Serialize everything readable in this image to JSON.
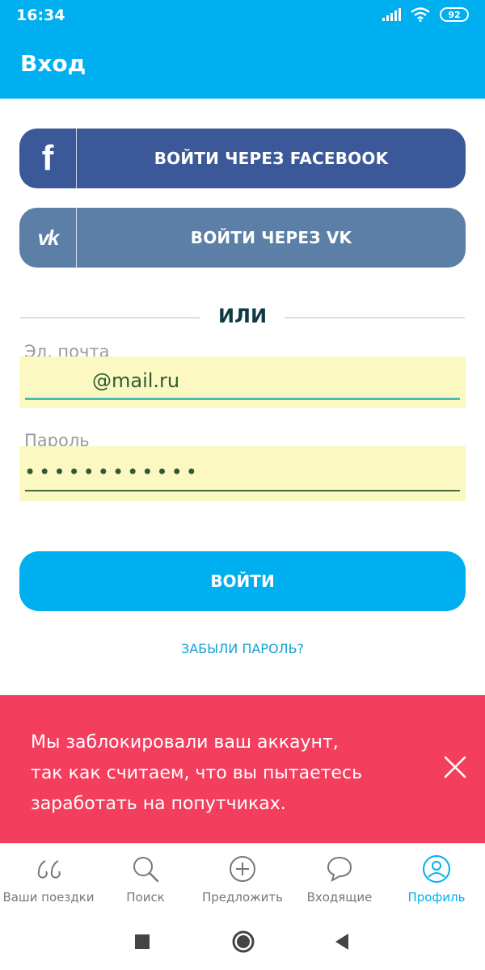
{
  "status": {
    "time": "16:34",
    "battery": "92"
  },
  "app_bar": {
    "title": "Вход"
  },
  "social": {
    "facebook_label": "ВОЙТИ ЧЕРЕЗ FACEBOOK",
    "vk_label": "ВОЙТИ ЧЕРЕЗ VK",
    "facebook_icon_glyph": "f",
    "vk_icon_glyph": "vk",
    "facebook_color": "#3b5998",
    "vk_color": "#5b7fa6"
  },
  "divider": {
    "text": "ИЛИ"
  },
  "form": {
    "email": {
      "label": "Эл. почта",
      "value": "@mail.ru"
    },
    "password": {
      "label": "Пароль",
      "value": "••••••••••••"
    },
    "submit_label": "ВОЙТИ",
    "forgot_label": "ЗАБЫЛИ ПАРОЛЬ?"
  },
  "banner": {
    "lines": [
      "Мы заблокировали ваш аккаунт,",
      "так как считаем, что вы пытаетесь",
      "заработать на попутчиках."
    ],
    "color": "#f43e5e"
  },
  "bottom_nav": {
    "items": [
      {
        "label": "Ваши поездки",
        "icon": "quote-icon",
        "active": false
      },
      {
        "label": "Поиск",
        "icon": "search-icon",
        "active": false
      },
      {
        "label": "Предложить",
        "icon": "plus-circle-icon",
        "active": false
      },
      {
        "label": "Входящие",
        "icon": "chat-icon",
        "active": false
      },
      {
        "label": "Профиль",
        "icon": "profile-icon",
        "active": true
      }
    ]
  },
  "colors": {
    "accent": "#00aff0",
    "link": "#129fd3",
    "autofill": "#fbf8c2"
  }
}
